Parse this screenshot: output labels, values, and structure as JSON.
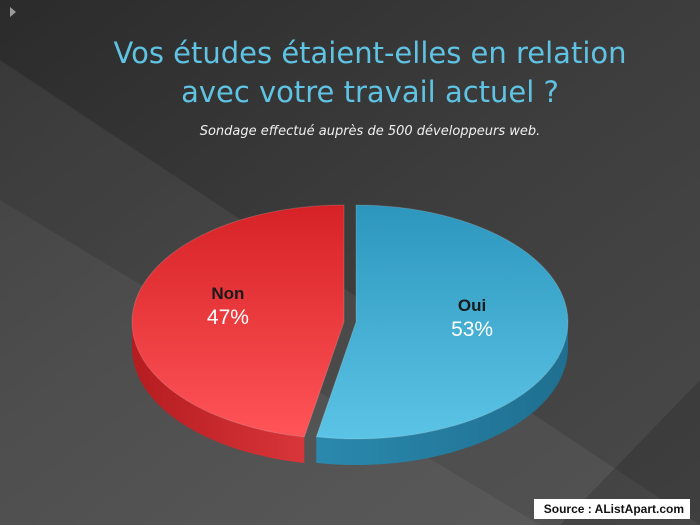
{
  "slide": {
    "title_line1": "Vos études étaient-elles en relation",
    "title_line2": "avec votre travail actuel ?",
    "subtitle": "Sondage effectué auprès de 500 développeurs web.",
    "source": "Source : AListApart.com"
  },
  "chart_data": {
    "type": "pie",
    "categories": [
      "Oui",
      "Non"
    ],
    "values": [
      53,
      47
    ],
    "value_labels": [
      "53%",
      "47%"
    ],
    "title": "Vos études étaient-elles en relation avec votre travail actuel ?",
    "subtitle": "Sondage effectué auprès de 500 développeurs web.",
    "colors": [
      "#3aa8cc",
      "#e8373c"
    ],
    "style": "3d"
  }
}
